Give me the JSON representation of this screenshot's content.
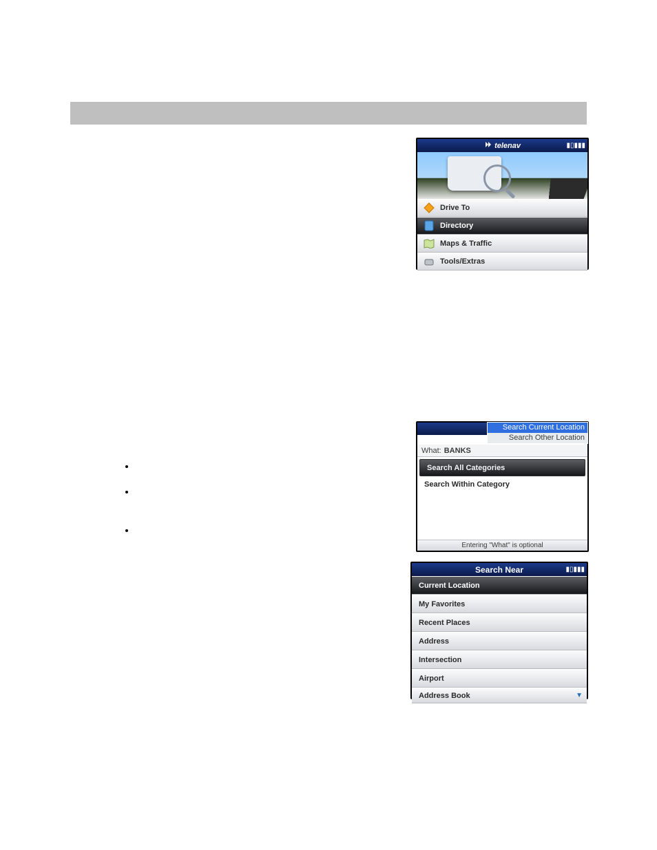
{
  "shot1": {
    "logo": "telenav",
    "signal": "▮▯▮▮▮",
    "menu": [
      {
        "label": "Drive To"
      },
      {
        "label": "Directory"
      },
      {
        "label": "Maps & Traffic"
      },
      {
        "label": "Tools/Extras"
      }
    ]
  },
  "shot2": {
    "overlay": {
      "selected": "Search Current Location",
      "other": "Search Other Location"
    },
    "what_label": "What:",
    "what_value": "BANKS",
    "row_search_all": "Search All Categories",
    "row_search_within": "Search Within Category",
    "footer": "Entering \"What\" is optional"
  },
  "shot3": {
    "title": "Search Near",
    "signal": "▮▯▮▮▮",
    "items": [
      "Current Location",
      "My Favorites",
      "Recent Places",
      "Address",
      "Intersection",
      "Airport",
      "Address Book"
    ],
    "more": "▼"
  }
}
